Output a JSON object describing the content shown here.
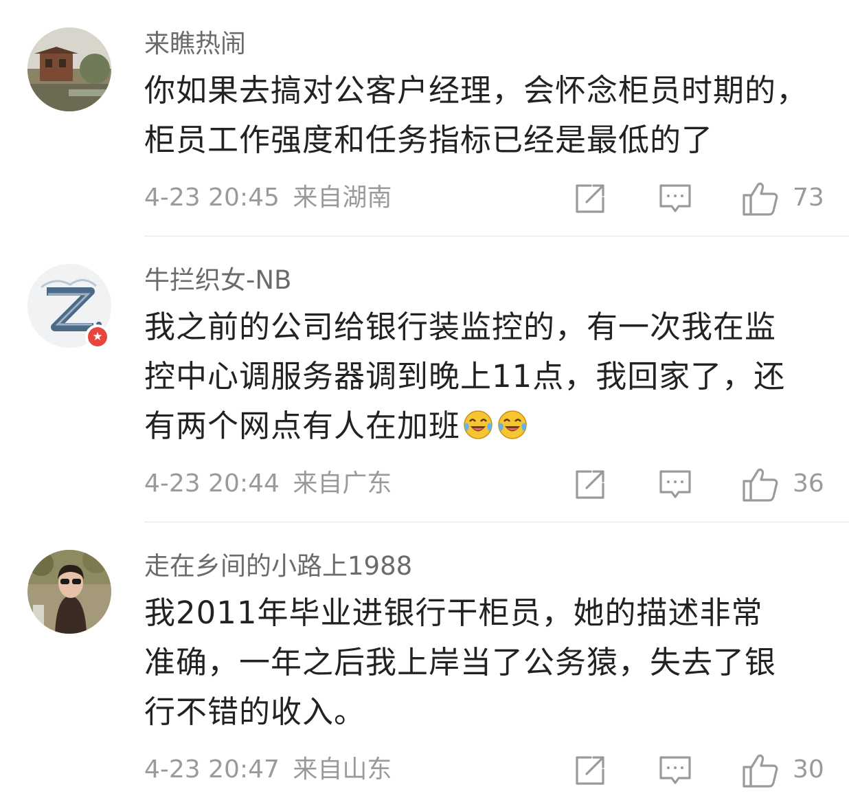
{
  "comments": [
    {
      "username": "来瞧热闹",
      "text_lines": [
        "你如果去搞对公客户经理，会怀念柜员时期的，",
        "柜员工作强度和任务指标已经是最低的了"
      ],
      "time": "4-23 20:45",
      "location": "来自湖南",
      "likes": "73",
      "verified": false
    },
    {
      "username": "牛拦织女-NB",
      "text_lines": [
        "我之前的公司给银行装监控的，有一次我在监",
        "控中心调服务器调到晚上11点，我回家了，还",
        "有两个网点有人在加班"
      ],
      "time": "4-23 20:44",
      "location": "来自广东",
      "likes": "36",
      "verified": true,
      "emojis": [
        "laugh-cry-emoji",
        "laugh-cry-emoji"
      ]
    },
    {
      "username": "走在乡间的小路上1988",
      "text_lines": [
        "我2011年毕业进银行干柜员，她的描述非常",
        "准确，一年之后我上岸当了公务猿，失去了银",
        "行不错的收入。"
      ],
      "time": "4-23 20:47",
      "location": "来自山东",
      "likes": "30",
      "verified": false
    }
  ],
  "icons": {
    "share": "share-icon",
    "reply": "comment-icon",
    "like": "thumbs-up-icon",
    "verified": "verified-badge-icon"
  },
  "colors": {
    "username": "#6b6b6b",
    "text": "#222222",
    "meta": "#9a9a9a",
    "divider": "#e3e3e3",
    "verified_badge": "#e8453c"
  }
}
